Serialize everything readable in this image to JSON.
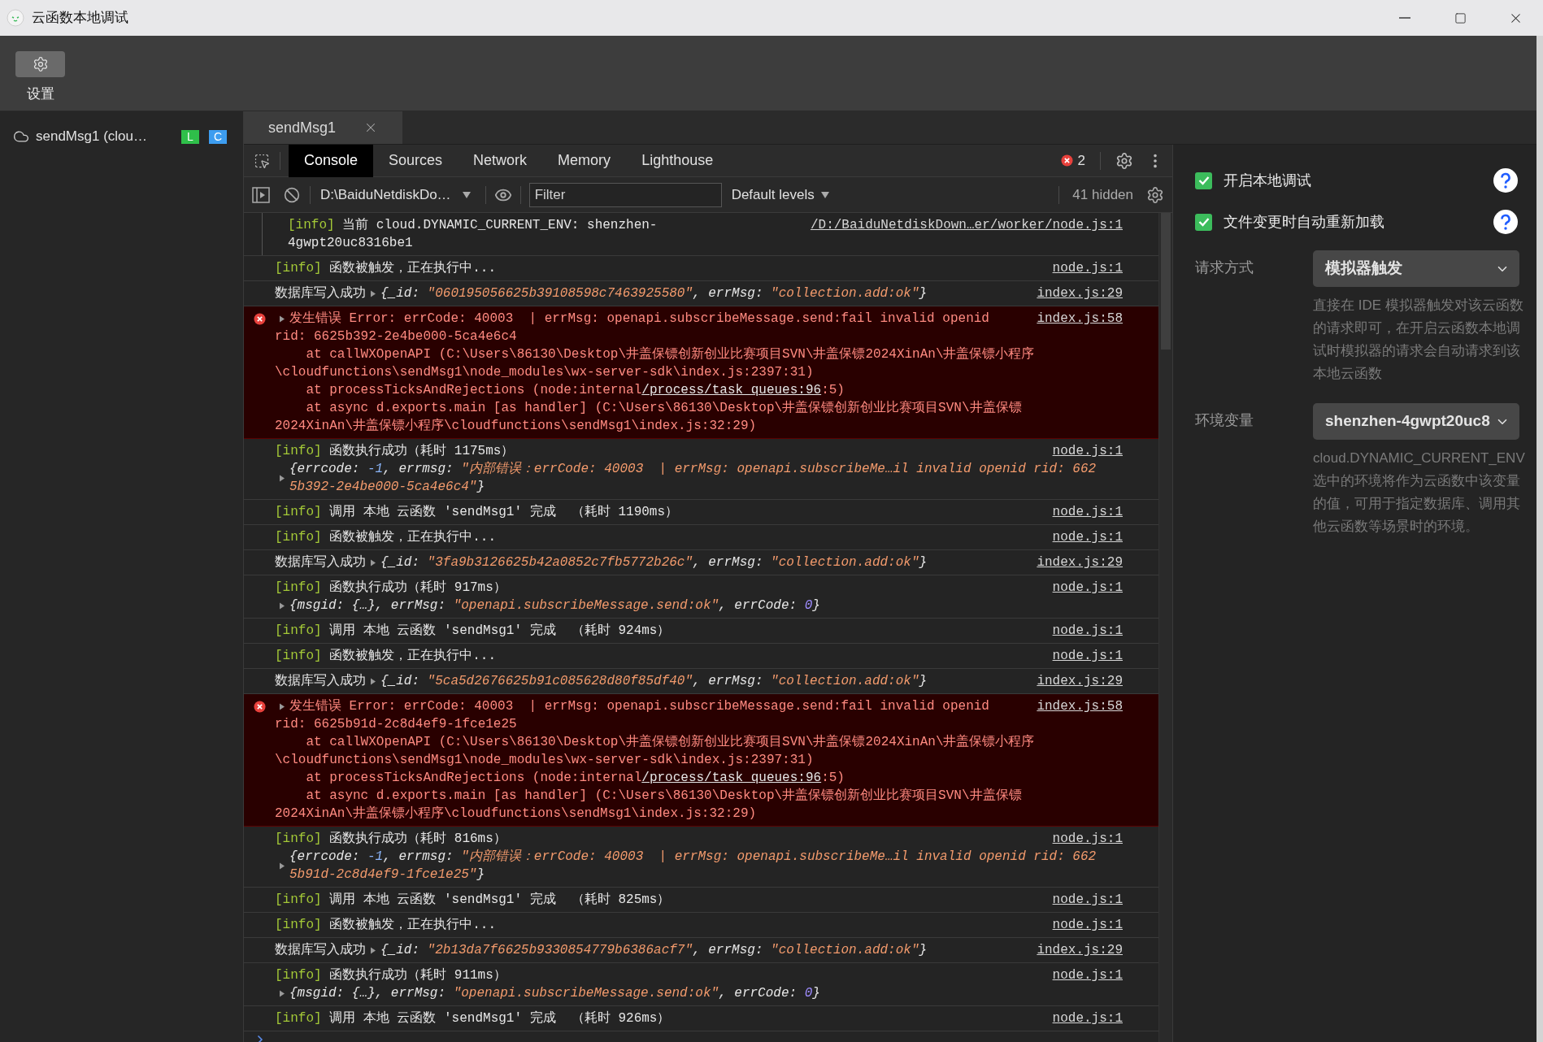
{
  "window": {
    "title": "云函数本地调试"
  },
  "toolbar": {
    "buttons": [
      {
        "label": "设置"
      }
    ]
  },
  "sidebar": {
    "items": [
      {
        "label": "sendMsg1 (clou…",
        "badges": [
          {
            "text": "L",
            "color": "#2fbf4a"
          },
          {
            "text": "C",
            "color": "#3d9df0"
          }
        ]
      }
    ]
  },
  "editor_tabs": [
    {
      "label": "sendMsg1",
      "selected": true
    }
  ],
  "devtools": {
    "tabs": [
      {
        "label": "Console",
        "selected": true
      },
      {
        "label": "Sources",
        "selected": false
      },
      {
        "label": "Network",
        "selected": false
      },
      {
        "label": "Memory",
        "selected": false
      },
      {
        "label": "Lighthouse",
        "selected": false
      }
    ],
    "error_count": "2",
    "context": "D:\\BaiduNetdiskDo…",
    "filter": {
      "placeholder": "Filter"
    },
    "levels": "Default levels",
    "hidden": "41 hidden"
  },
  "console": [
    {
      "kind": "info",
      "nested": true,
      "source": "/D:/BaiduNetdiskDown…er/worker/node.js:1",
      "lines": [
        [
          {
            "t": "[info]",
            "kind": "tag"
          },
          {
            "t": " 当前 cloud.DYNAMIC_CURRENT_ENV: shenzhen-",
            "kind": "plain"
          }
        ],
        [
          {
            "t": "4gwpt20uc8316be1",
            "kind": "plain"
          }
        ]
      ]
    },
    {
      "kind": "info",
      "nested": false,
      "source": "node.js:1",
      "lines": [
        [
          {
            "t": "[info]",
            "kind": "tag"
          },
          {
            "t": " 函数被触发，正在执行中...",
            "kind": "plain"
          }
        ]
      ]
    },
    {
      "kind": "info",
      "nested": false,
      "source": "index.js:29",
      "lines": [
        [
          {
            "t": "数据库写入成功",
            "kind": "plain"
          },
          {
            "kind": "toggle"
          },
          {
            "t": "{_id: ",
            "kind": "obj"
          },
          {
            "t": "\"060195056625b39108598c7463925580\"",
            "kind": "str"
          },
          {
            "t": ", errMsg: ",
            "kind": "obj"
          },
          {
            "t": "\"collection.add:ok\"",
            "kind": "str"
          },
          {
            "t": "}",
            "kind": "obj"
          }
        ]
      ]
    },
    {
      "kind": "error",
      "nested": false,
      "source": "index.js:58",
      "lines": [
        [
          {
            "kind": "toggle"
          },
          {
            "t": "发生错误 Error: errCode: 40003  | errMsg: openapi.subscribeMessage.send:fail invalid openid",
            "kind": "err"
          }
        ],
        [
          {
            "t": "rid: 6625b392-2e4be000-5ca4e6c4",
            "kind": "err"
          }
        ],
        [
          {
            "t": "    at callWXOpenAPI (C:\\Users\\86130\\Desktop\\井盖保镖创新创业比赛项目SVN\\井盖保镖2024XinAn\\井盖保镖小程序",
            "kind": "err"
          }
        ],
        [
          {
            "t": "\\cloudfunctions\\sendMsg1\\node_modules\\wx-server-sdk\\index.js:2397:31)",
            "kind": "err"
          }
        ],
        [
          {
            "t": "    at processTicksAndRejections (node:internal",
            "kind": "err"
          },
          {
            "t": "/process/task_queues:96",
            "kind": "link"
          },
          {
            "t": ":5)",
            "kind": "err"
          }
        ],
        [
          {
            "t": "    at async d.exports.main [as handler] (C:\\Users\\86130\\Desktop\\井盖保镖创新创业比赛项目SVN\\井盖保镖",
            "kind": "err"
          }
        ],
        [
          {
            "t": "2024XinAn\\井盖保镖小程序\\cloudfunctions\\sendMsg1\\index.js:32:29)",
            "kind": "err"
          }
        ]
      ]
    },
    {
      "kind": "info",
      "nested": false,
      "source": "node.js:1",
      "lines": [
        [
          {
            "t": "[info]",
            "kind": "tag"
          },
          {
            "t": " 函数执行成功（耗时 1175ms）",
            "kind": "plain"
          }
        ]
      ],
      "object": [
        [
          {
            "t": "{errcode: ",
            "kind": "obj"
          },
          {
            "t": "-1",
            "kind": "neg"
          },
          {
            "t": ", errmsg: ",
            "kind": "obj"
          },
          {
            "t": "\"内部错误：errCode: 40003  | errMsg: openapi.subscribeMe…il invalid openid rid: 662",
            "kind": "str"
          }
        ],
        [
          {
            "t": "5b392-2e4be000-5ca4e6c4\"",
            "kind": "str"
          },
          {
            "t": "}",
            "kind": "obj"
          }
        ]
      ]
    },
    {
      "kind": "info",
      "nested": false,
      "source": "node.js:1",
      "lines": [
        [
          {
            "t": "[info]",
            "kind": "tag"
          },
          {
            "t": " 调用 本地 云函数 'sendMsg1' 完成  （耗时 1190ms）",
            "kind": "plain"
          }
        ]
      ]
    },
    {
      "kind": "info",
      "nested": false,
      "source": "node.js:1",
      "lines": [
        [
          {
            "t": "[info]",
            "kind": "tag"
          },
          {
            "t": " 函数被触发，正在执行中...",
            "kind": "plain"
          }
        ]
      ]
    },
    {
      "kind": "info",
      "nested": false,
      "source": "index.js:29",
      "lines": [
        [
          {
            "t": "数据库写入成功",
            "kind": "plain"
          },
          {
            "kind": "toggle"
          },
          {
            "t": "{_id: ",
            "kind": "obj"
          },
          {
            "t": "\"3fa9b3126625b42a0852c7fb5772b26c\"",
            "kind": "str"
          },
          {
            "t": ", errMsg: ",
            "kind": "obj"
          },
          {
            "t": "\"collection.add:ok\"",
            "kind": "str"
          },
          {
            "t": "}",
            "kind": "obj"
          }
        ]
      ]
    },
    {
      "kind": "info",
      "nested": false,
      "source": "node.js:1",
      "lines": [
        [
          {
            "t": "[info]",
            "kind": "tag"
          },
          {
            "t": " 函数执行成功（耗时 917ms）",
            "kind": "plain"
          }
        ]
      ],
      "object": [
        [
          {
            "t": "{msgid: {…}, errMsg: ",
            "kind": "obj"
          },
          {
            "t": "\"openapi.subscribeMessage.send:ok\"",
            "kind": "str"
          },
          {
            "t": ", errCode: ",
            "kind": "obj"
          },
          {
            "t": "0",
            "kind": "num"
          },
          {
            "t": "}",
            "kind": "obj"
          }
        ]
      ]
    },
    {
      "kind": "info",
      "nested": false,
      "source": "node.js:1",
      "lines": [
        [
          {
            "t": "[info]",
            "kind": "tag"
          },
          {
            "t": " 调用 本地 云函数 'sendMsg1' 完成  （耗时 924ms）",
            "kind": "plain"
          }
        ]
      ]
    },
    {
      "kind": "info",
      "nested": false,
      "source": "node.js:1",
      "lines": [
        [
          {
            "t": "[info]",
            "kind": "tag"
          },
          {
            "t": " 函数被触发，正在执行中...",
            "kind": "plain"
          }
        ]
      ]
    },
    {
      "kind": "info",
      "nested": false,
      "source": "index.js:29",
      "lines": [
        [
          {
            "t": "数据库写入成功",
            "kind": "plain"
          },
          {
            "kind": "toggle"
          },
          {
            "t": "{_id: ",
            "kind": "obj"
          },
          {
            "t": "\"5ca5d2676625b91c085628d80f85df40\"",
            "kind": "str"
          },
          {
            "t": ", errMsg: ",
            "kind": "obj"
          },
          {
            "t": "\"collection.add:ok\"",
            "kind": "str"
          },
          {
            "t": "}",
            "kind": "obj"
          }
        ]
      ]
    },
    {
      "kind": "error",
      "nested": false,
      "source": "index.js:58",
      "lines": [
        [
          {
            "kind": "toggle"
          },
          {
            "t": "发生错误 Error: errCode: 40003  | errMsg: openapi.subscribeMessage.send:fail invalid openid",
            "kind": "err"
          }
        ],
        [
          {
            "t": "rid: 6625b91d-2c8d4ef9-1fce1e25",
            "kind": "err"
          }
        ],
        [
          {
            "t": "    at callWXOpenAPI (C:\\Users\\86130\\Desktop\\井盖保镖创新创业比赛项目SVN\\井盖保镖2024XinAn\\井盖保镖小程序",
            "kind": "err"
          }
        ],
        [
          {
            "t": "\\cloudfunctions\\sendMsg1\\node_modules\\wx-server-sdk\\index.js:2397:31)",
            "kind": "err"
          }
        ],
        [
          {
            "t": "    at processTicksAndRejections (node:internal",
            "kind": "err"
          },
          {
            "t": "/process/task_queues:96",
            "kind": "link"
          },
          {
            "t": ":5)",
            "kind": "err"
          }
        ],
        [
          {
            "t": "    at async d.exports.main [as handler] (C:\\Users\\86130\\Desktop\\井盖保镖创新创业比赛项目SVN\\井盖保镖",
            "kind": "err"
          }
        ],
        [
          {
            "t": "2024XinAn\\井盖保镖小程序\\cloudfunctions\\sendMsg1\\index.js:32:29)",
            "kind": "err"
          }
        ]
      ]
    },
    {
      "kind": "info",
      "nested": false,
      "source": "node.js:1",
      "lines": [
        [
          {
            "t": "[info]",
            "kind": "tag"
          },
          {
            "t": " 函数执行成功（耗时 816ms）",
            "kind": "plain"
          }
        ]
      ],
      "object": [
        [
          {
            "t": "{errcode: ",
            "kind": "obj"
          },
          {
            "t": "-1",
            "kind": "neg"
          },
          {
            "t": ", errmsg: ",
            "kind": "obj"
          },
          {
            "t": "\"内部错误：errCode: 40003  | errMsg: openapi.subscribeMe…il invalid openid rid: 662",
            "kind": "str"
          }
        ],
        [
          {
            "t": "5b91d-2c8d4ef9-1fce1e25\"",
            "kind": "str"
          },
          {
            "t": "}",
            "kind": "obj"
          }
        ]
      ]
    },
    {
      "kind": "info",
      "nested": false,
      "source": "node.js:1",
      "lines": [
        [
          {
            "t": "[info]",
            "kind": "tag"
          },
          {
            "t": " 调用 本地 云函数 'sendMsg1' 完成  （耗时 825ms）",
            "kind": "plain"
          }
        ]
      ]
    },
    {
      "kind": "info",
      "nested": false,
      "source": "node.js:1",
      "lines": [
        [
          {
            "t": "[info]",
            "kind": "tag"
          },
          {
            "t": " 函数被触发，正在执行中...",
            "kind": "plain"
          }
        ]
      ]
    },
    {
      "kind": "info",
      "nested": false,
      "source": "index.js:29",
      "lines": [
        [
          {
            "t": "数据库写入成功",
            "kind": "plain"
          },
          {
            "kind": "toggle"
          },
          {
            "t": "{_id: ",
            "kind": "obj"
          },
          {
            "t": "\"2b13da7f6625b9330854779b6386acf7\"",
            "kind": "str"
          },
          {
            "t": ", errMsg: ",
            "kind": "obj"
          },
          {
            "t": "\"collection.add:ok\"",
            "kind": "str"
          },
          {
            "t": "}",
            "kind": "obj"
          }
        ]
      ]
    },
    {
      "kind": "info",
      "nested": false,
      "source": "node.js:1",
      "lines": [
        [
          {
            "t": "[info]",
            "kind": "tag"
          },
          {
            "t": " 函数执行成功（耗时 911ms）",
            "kind": "plain"
          }
        ]
      ],
      "object": [
        [
          {
            "t": "{msgid: {…}, errMsg: ",
            "kind": "obj"
          },
          {
            "t": "\"openapi.subscribeMessage.send:ok\"",
            "kind": "str"
          },
          {
            "t": ", errCode: ",
            "kind": "obj"
          },
          {
            "t": "0",
            "kind": "num"
          },
          {
            "t": "}",
            "kind": "obj"
          }
        ]
      ]
    },
    {
      "kind": "info",
      "nested": false,
      "source": "node.js:1",
      "lines": [
        [
          {
            "t": "[info]",
            "kind": "tag"
          },
          {
            "t": " 调用 本地 云函数 'sendMsg1' 完成  （耗时 926ms）",
            "kind": "plain"
          }
        ]
      ]
    }
  ],
  "settings_panel": {
    "options": [
      {
        "label": "开启本地调试",
        "checked": true
      },
      {
        "label": "文件变更时自动重新加载",
        "checked": true
      }
    ],
    "fields": [
      {
        "label": "请求方式",
        "value": "模拟器触发",
        "description": "直接在 IDE 模拟器触发对该云函数的请求即可，在开启云函数本地调试时模拟器的请求会自动请求到该本地云函数"
      },
      {
        "label": "环境变量",
        "value": "shenzhen-4gwpt20uc8",
        "description": "cloud.DYNAMIC_CURRENT_ENV 选中的环境将作为云函数中该变量的值，可用于指定数据库、调用其他云函数等场景时的环境。"
      }
    ]
  }
}
